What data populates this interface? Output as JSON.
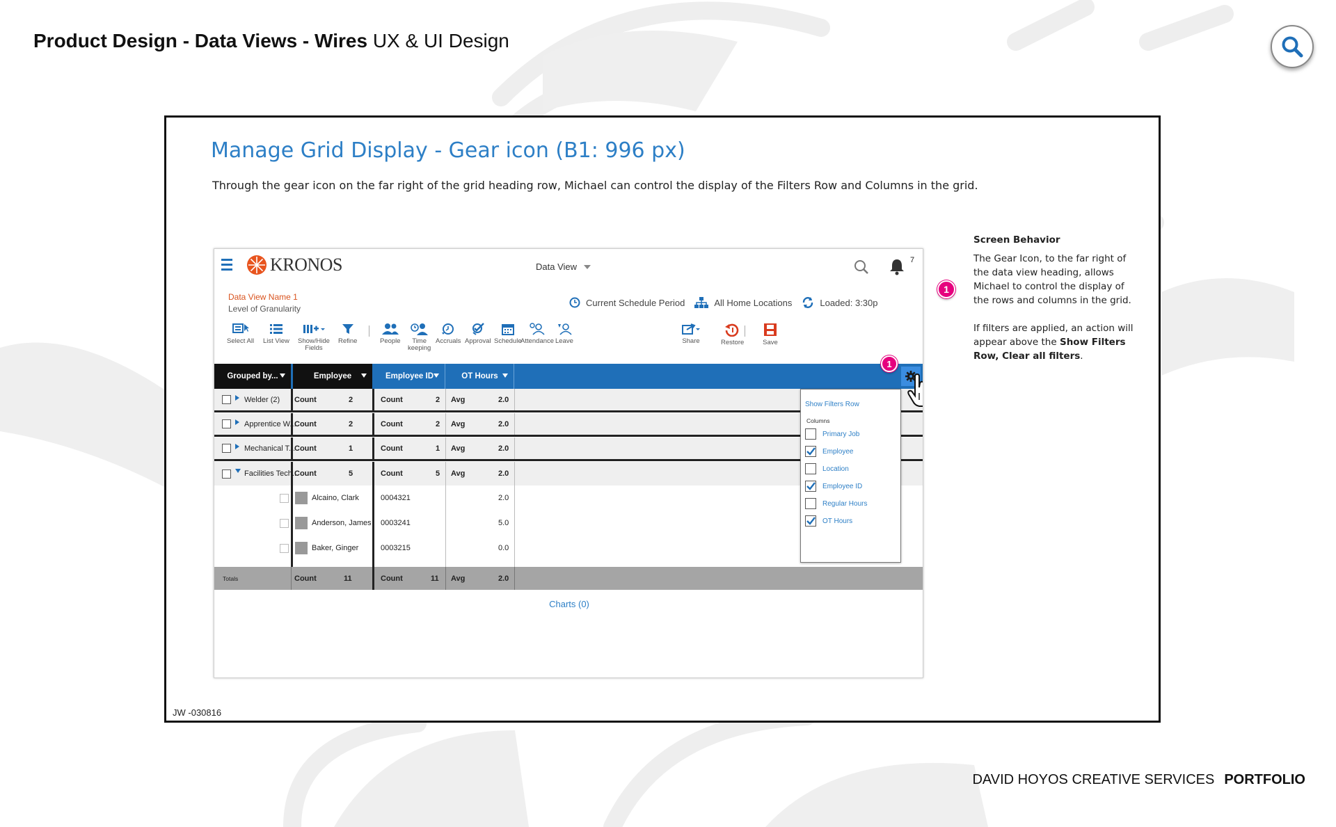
{
  "header": {
    "title_bold": "Product Design - Data Views - Wires",
    "title_rest": "UX & UI Design"
  },
  "footer": {
    "brand": "DAVID HOYOS CREATIVE SERVICES",
    "portfolio": "PORTFOLIO"
  },
  "frame": {
    "title": "Manage Grid Display - Gear icon (B1: 996 px)",
    "description": "Through the gear icon on the far right of the grid heading row, Michael can control the display of the Filters Row and Columns in the grid.",
    "code": "JW -030816"
  },
  "screen_behavior": {
    "title": "Screen Behavior",
    "p1": "The Gear Icon, to the far right of the data view heading, allows Michael to control the display of the rows and columns in the grid.",
    "p2_start": "If filters are applied, an action will appear above the ",
    "p2_bold1": "Show Filters Row, Clear all filters",
    "p2_end": ".",
    "badge": "1"
  },
  "app": {
    "logo": "KRONOS",
    "view_select": "Data View",
    "notification_count": "7",
    "data_view_name": "Data View Name 1",
    "granularity": "Level of Granularity",
    "status": {
      "period": "Current Schedule Period",
      "locations": "All Home Locations",
      "loaded": "Loaded: 3:30p"
    },
    "toolbar": {
      "select_all": "Select All",
      "list_view": "List View",
      "show_hide_1": "Show/Hide",
      "show_hide_2": "Fields",
      "refine": "Refine",
      "people": "People",
      "time_1": "Time",
      "time_2": "keeping",
      "accruals": "Accruals",
      "approval": "Approval",
      "schedule": "Schedule",
      "attendance": "Attendance",
      "leave": "Leave",
      "share": "Share",
      "restore": "Restore",
      "save": "Save"
    },
    "grid": {
      "headers": [
        "Grouped by...",
        "Employee",
        "Employee ID",
        "OT Hours"
      ],
      "groups": [
        {
          "name": "Welder (2)",
          "label1": "Count",
          "v1": "2",
          "label2": "Count",
          "v2": "2",
          "label3": "Avg",
          "v3": "2.0"
        },
        {
          "name": "Apprentice W...",
          "label1": "Count",
          "v1": "2",
          "label2": "Count",
          "v2": "2",
          "label3": "Avg",
          "v3": "2.0"
        },
        {
          "name": "Mechanical T...",
          "label1": "Count",
          "v1": "1",
          "label2": "Count",
          "v2": "1",
          "label3": "Avg",
          "v3": "2.0"
        },
        {
          "name": "Facilities Tech...",
          "label1": "Count",
          "v1": "5",
          "label2": "Count",
          "v2": "5",
          "label3": "Avg",
          "v3": "2.0"
        }
      ],
      "employees": [
        {
          "name": "Alcaino, Clark",
          "id": "0004321",
          "ot": "2.0"
        },
        {
          "name": "Anderson, James",
          "id": "0003241",
          "ot": "5.0"
        },
        {
          "name": "Baker, Ginger",
          "id": "0003215",
          "ot": "0.0"
        }
      ],
      "totals": {
        "label": "Totals",
        "l1": "Count",
        "v1": "11",
        "l2": "Count",
        "v2": "11",
        "l3": "Avg",
        "v3": "2.0"
      },
      "charts_link": "Charts (0)"
    },
    "panel": {
      "show_filters": "Show Filters Row",
      "columns_label": "Columns",
      "columns": [
        {
          "label": "Primary Job",
          "checked": false
        },
        {
          "label": "Employee",
          "checked": true
        },
        {
          "label": "Location",
          "checked": false
        },
        {
          "label": "Employee ID",
          "checked": true
        },
        {
          "label": "Regular Hours",
          "checked": false
        },
        {
          "label": "OT Hours",
          "checked": true
        }
      ]
    }
  },
  "colors": {
    "accent_blue": "#1f6fb8",
    "badge_pink": "#e6007e",
    "kronos_orange": "#e8541e"
  }
}
